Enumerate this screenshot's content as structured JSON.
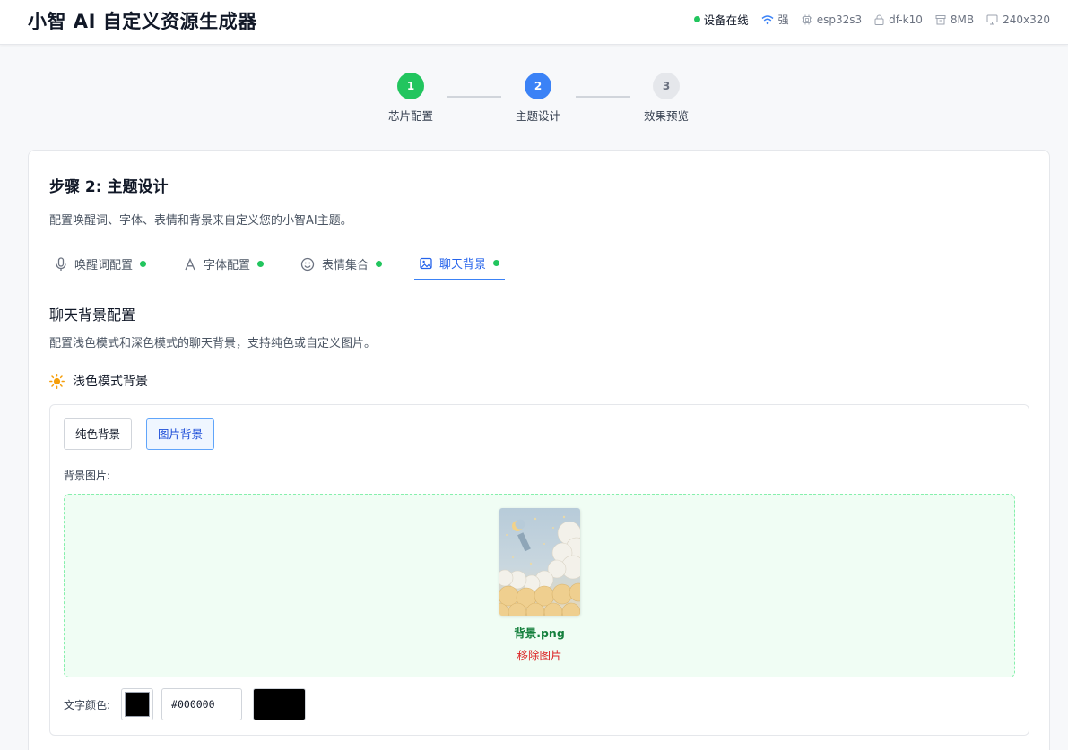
{
  "app": {
    "title": "小智 AI 自定义资源生成器"
  },
  "status": {
    "online": "设备在线",
    "signal": "强",
    "chip": "esp32s3",
    "board": "df-k10",
    "flash": "8MB",
    "resolution": "240x320",
    "online_color": "#22c55e"
  },
  "stepper": {
    "steps": [
      {
        "number": "1",
        "label": "芯片配置",
        "state": "done"
      },
      {
        "number": "2",
        "label": "主题设计",
        "state": "active"
      },
      {
        "number": "3",
        "label": "效果预览",
        "state": "todo"
      }
    ]
  },
  "card": {
    "title": "步骤 2: 主题设计",
    "description": "配置唤醒词、字体、表情和背景来自定义您的小智AI主题。"
  },
  "tabs": [
    {
      "label": "唤醒词配置",
      "icon": "microphone-icon",
      "done": true
    },
    {
      "label": "字体配置",
      "icon": "font-icon",
      "done": true
    },
    {
      "label": "表情集合",
      "icon": "smile-icon",
      "done": true
    },
    {
      "label": "聊天背景",
      "icon": "image-icon",
      "done": true,
      "active": true
    }
  ],
  "background": {
    "section_title": "聊天背景配置",
    "section_desc": "配置浅色模式和深色模式的聊天背景，支持纯色或自定义图片。",
    "light_mode_title": "浅色模式背景",
    "solid_button": "纯色背景",
    "image_button": "图片背景",
    "selected_type": "图片背景",
    "image_label": "背景图片:",
    "filename": "背景.png",
    "remove_label": "移除图片",
    "text_color_label": "文字颜色:",
    "text_color": "#000000"
  }
}
